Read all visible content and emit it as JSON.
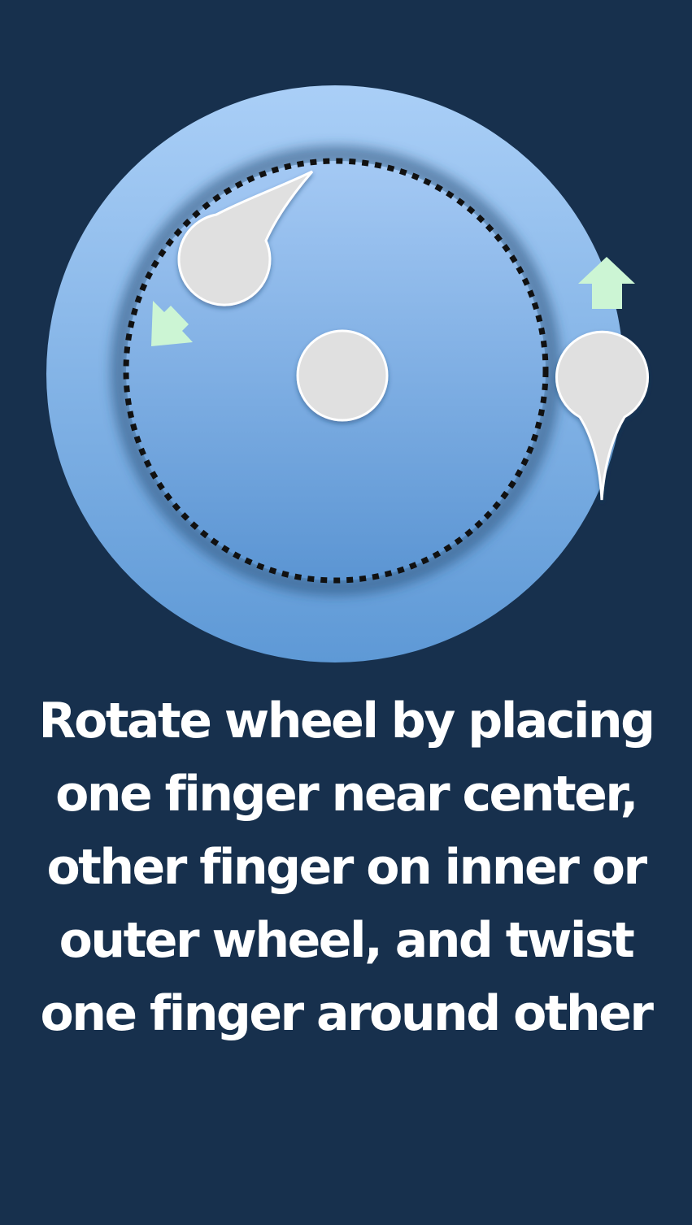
{
  "instruction": {
    "lines": [
      "Rotate wheel by placing",
      "one finger near center,",
      "other finger on inner or",
      "outer wheel, and twist",
      "one finger around other"
    ]
  },
  "colors": {
    "background": "#17304d",
    "outer_wheel_light": "#a9cdf6",
    "outer_wheel_dark": "#5f9bd8",
    "finger": "#e0e0e0",
    "finger_outline": "#ffffff",
    "arrow": "#ccf5d4",
    "dotted_ring": "#111111"
  },
  "icons": {
    "inner_finger": "teardrop-finger-icon",
    "center_finger": "round-finger-icon",
    "outer_finger": "teardrop-finger-icon",
    "inner_arrow": "arrow-down-left-icon",
    "outer_arrow": "arrow-up-icon"
  }
}
